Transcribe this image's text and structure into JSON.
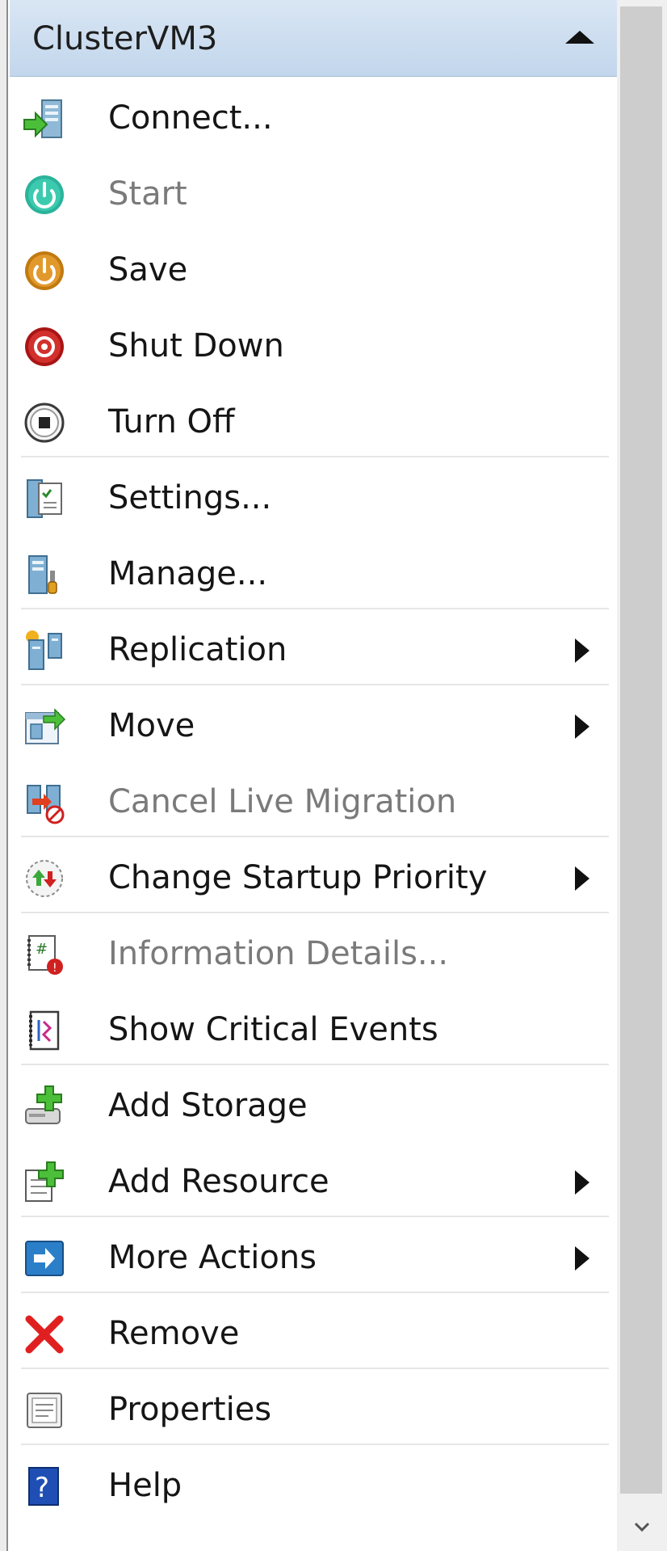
{
  "header": {
    "title": "ClusterVM3",
    "collapse_icon": "collapse-up-arrow"
  },
  "items": [
    {
      "label": "Connect...",
      "icon": "connect-icon",
      "enabled": true,
      "submenu": false
    },
    {
      "label": "Start",
      "icon": "start-power-icon",
      "enabled": false,
      "submenu": false
    },
    {
      "label": "Save",
      "icon": "save-power-icon",
      "enabled": true,
      "submenu": false
    },
    {
      "label": "Shut Down",
      "icon": "shutdown-icon",
      "enabled": true,
      "submenu": false
    },
    {
      "label": "Turn Off",
      "icon": "turn-off-icon",
      "enabled": true,
      "submenu": false
    },
    {
      "label": "Settings...",
      "icon": "settings-icon",
      "enabled": true,
      "submenu": false
    },
    {
      "label": "Manage...",
      "icon": "manage-icon",
      "enabled": true,
      "submenu": false
    },
    {
      "label": "Replication",
      "icon": "replication-icon",
      "enabled": true,
      "submenu": true
    },
    {
      "label": "Move",
      "icon": "move-icon",
      "enabled": true,
      "submenu": true
    },
    {
      "label": "Cancel Live Migration",
      "icon": "cancel-migration-icon",
      "enabled": false,
      "submenu": false
    },
    {
      "label": "Change Startup Priority",
      "icon": "startup-priority-icon",
      "enabled": true,
      "submenu": true
    },
    {
      "label": "Information Details...",
      "icon": "information-details-icon",
      "enabled": false,
      "submenu": false
    },
    {
      "label": "Show Critical Events",
      "icon": "critical-events-icon",
      "enabled": true,
      "submenu": false
    },
    {
      "label": "Add Storage",
      "icon": "add-storage-icon",
      "enabled": true,
      "submenu": false
    },
    {
      "label": "Add Resource",
      "icon": "add-resource-icon",
      "enabled": true,
      "submenu": true
    },
    {
      "label": "More Actions",
      "icon": "more-actions-icon",
      "enabled": true,
      "submenu": true
    },
    {
      "label": "Remove",
      "icon": "remove-icon",
      "enabled": true,
      "submenu": false
    },
    {
      "label": "Properties",
      "icon": "properties-icon",
      "enabled": true,
      "submenu": false
    },
    {
      "label": "Help",
      "icon": "help-icon",
      "enabled": true,
      "submenu": false
    }
  ],
  "colors": {
    "header_bg": "#c9dbee",
    "text": "#151515",
    "disabled_text": "#7a7a7a",
    "start_green": "#2bb39b",
    "save_orange": "#d68a1c",
    "shutdown_red": "#c0201f",
    "remove_red": "#e02020",
    "help_blue": "#1f4fb5"
  }
}
